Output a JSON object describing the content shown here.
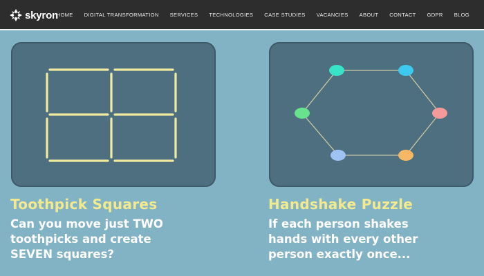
{
  "brand": {
    "name": "skyron"
  },
  "nav": {
    "items": [
      {
        "label": "HOME",
        "key": "home"
      },
      {
        "label": "DIGITAL TRANSFORMATION",
        "key": "digital-transformation"
      },
      {
        "label": "SERVICES",
        "key": "services"
      },
      {
        "label": "TECHNOLOGIES",
        "key": "technologies"
      },
      {
        "label": "CASE STUDIES",
        "key": "case-studies"
      },
      {
        "label": "VACANCIES",
        "key": "vacancies"
      },
      {
        "label": "ABOUT",
        "key": "about"
      },
      {
        "label": "CONTACT",
        "key": "contact"
      },
      {
        "label": "GDPR",
        "key": "gdpr"
      },
      {
        "label": "BLOG",
        "key": "blog"
      }
    ]
  },
  "puzzles": [
    {
      "title": "Toothpick Squares",
      "description": [
        "Can you move just TWO",
        "toothpicks and create",
        "SEVEN squares?"
      ],
      "illustration": "toothpick-grid"
    },
    {
      "title": "Handshake Puzzle",
      "description": [
        "If each person shakes",
        "hands with every other",
        "person exactly once..."
      ],
      "illustration": "hexagon-people"
    }
  ],
  "colors": {
    "page_background": "#82b3c4",
    "navbar": "#2d2d2d",
    "card": "#4e6f80",
    "title": "#f3e98e",
    "toothpick": "#f1eba0",
    "nodes": [
      "#39e3c8",
      "#3ec9ee",
      "#f59a9a",
      "#f7b866",
      "#9fc3f2",
      "#66e38c"
    ]
  }
}
